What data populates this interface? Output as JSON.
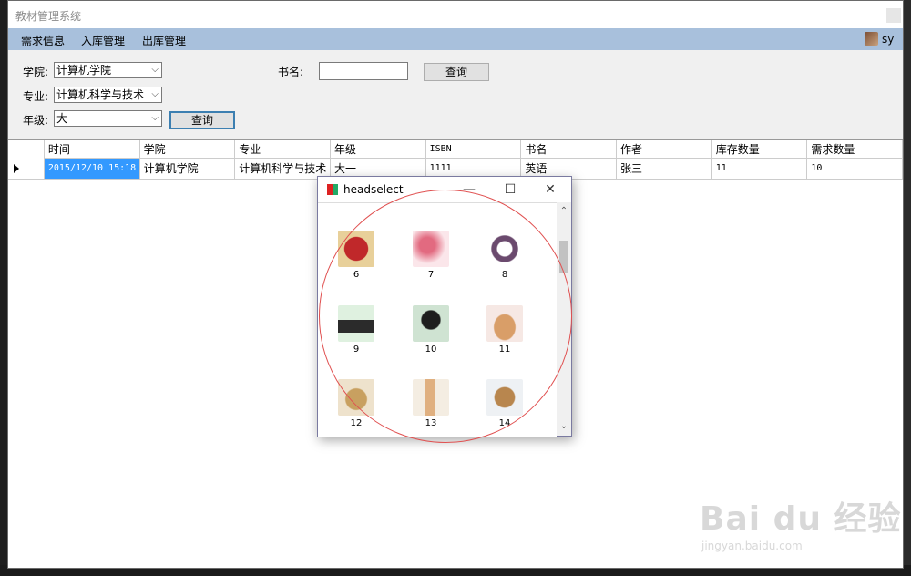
{
  "app": {
    "title": "教材管理系统",
    "user": "sy"
  },
  "menu": {
    "items": [
      "需求信息",
      "入库管理",
      "出库管理"
    ]
  },
  "filters": {
    "college_label": "学院:",
    "college_value": "计算机学院",
    "major_label": "专业:",
    "major_value": "计算机科学与技术",
    "grade_label": "年级:",
    "grade_value": "大一",
    "book_label": "书名:",
    "book_value": "",
    "search_left": "查询",
    "search_right": "查询"
  },
  "grid": {
    "columns": [
      "时间",
      "学院",
      "专业",
      "年级",
      "ISBN",
      "书名",
      "作者",
      "库存数量",
      "需求数量"
    ],
    "rows": [
      [
        "2015/12/10 15:18",
        "计算机学院",
        "计算机科学与技术",
        "大一",
        "1111",
        "英语",
        "张三",
        "11",
        "10"
      ]
    ]
  },
  "popup": {
    "title": "headselect",
    "minimize": "—",
    "maximize": "☐",
    "close": "✕",
    "scroll_up": "⌃",
    "scroll_down": "⌄",
    "heads": [
      {
        "num": "6",
        "icon": "red-heart-icon",
        "color": "#c0282a"
      },
      {
        "num": "7",
        "icon": "lipstick-icon",
        "color": "#e8a0b0"
      },
      {
        "num": "8",
        "icon": "round-logo-icon",
        "color": "#6b4a6e"
      },
      {
        "num": "9",
        "icon": "black-cat-icon",
        "color": "#2b2b2b"
      },
      {
        "num": "10",
        "icon": "black-bird-icon",
        "color": "#3a4a3a"
      },
      {
        "num": "11",
        "icon": "sleeping-cat-icon",
        "color": "#d99e68"
      },
      {
        "num": "12",
        "icon": "deer-icon",
        "color": "#c8a060"
      },
      {
        "num": "13",
        "icon": "giraffe-icon",
        "color": "#e0b080"
      },
      {
        "num": "14",
        "icon": "teddy-bear-icon",
        "color": "#b8864e"
      }
    ]
  },
  "watermark": {
    "main": "Bai du 经验",
    "sub": "jingyan.baidu.com"
  }
}
